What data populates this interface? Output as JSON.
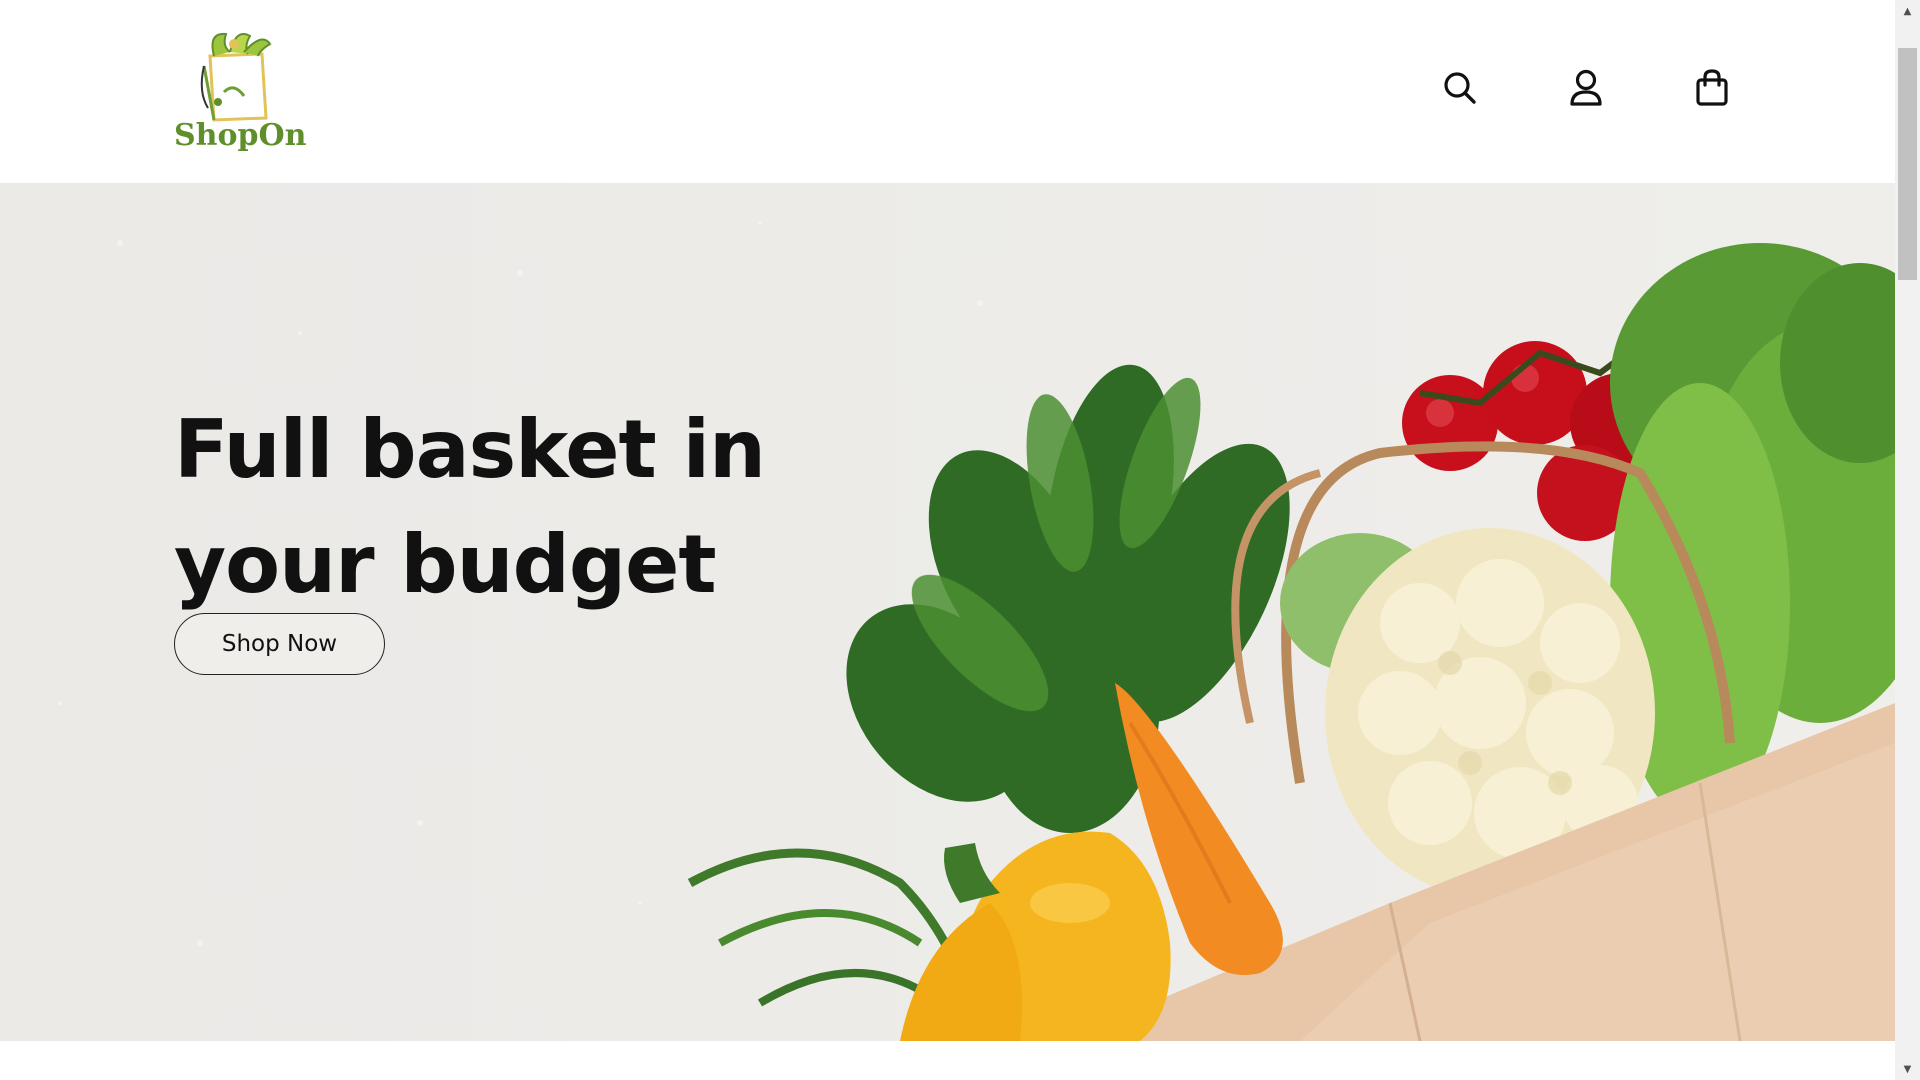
{
  "brand": {
    "name": "ShopOn"
  },
  "header": {
    "icons": {
      "search": "search-icon",
      "account": "user-icon",
      "cart": "shopping-bag-icon"
    }
  },
  "hero": {
    "title_line1": "Full basket in",
    "title_line2": "your budget",
    "cta_label": "Shop Now"
  },
  "colors": {
    "brand_green": "#5f8f2a",
    "text": "#111111",
    "hero_bg": "#ecebe8"
  }
}
